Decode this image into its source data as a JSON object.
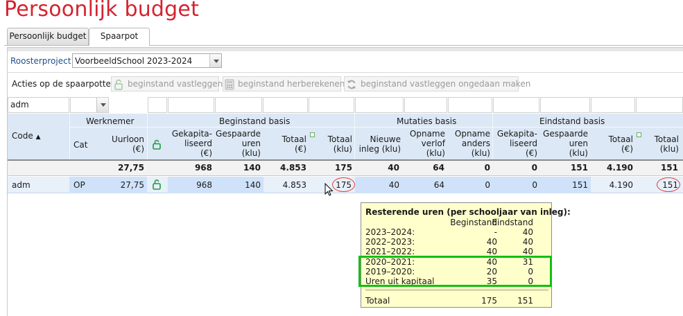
{
  "page": {
    "title": "Persoonlijk budget"
  },
  "tabs": [
    {
      "label": "Persoonlijk budget",
      "active": false
    },
    {
      "label": "Spaarpot",
      "active": true
    }
  ],
  "toolbar": {
    "project_label": "Roosterproject :",
    "project_value": "VoorbeeldSchool 2023-2024",
    "actions_label": "Acties op de spaarpotten:",
    "buttons": [
      {
        "label": "beginstand vastleggen",
        "icon": "lock-open-icon"
      },
      {
        "label": "beginstand herberekenen",
        "icon": "calculator-icon"
      },
      {
        "label": "beginstand vastleggen ongedaan maken",
        "icon": "undo-refresh-icon"
      }
    ]
  },
  "filter": {
    "code_value": "adm"
  },
  "table": {
    "groups": {
      "werknemer": "Werknemer",
      "beginstand": "Beginstand basis",
      "mutaties": "Mutaties basis",
      "eindstand": "Eindstand basis"
    },
    "columns": {
      "code": "Code",
      "cat": "Cat",
      "uurloon": [
        "Uurloon",
        "(€)"
      ],
      "b_kap": [
        "Gekapita-",
        "liseerd",
        "(€)"
      ],
      "b_gesp": [
        "Gespaarde",
        "uren",
        "(klu)"
      ],
      "b_tot_eur": [
        "Totaal",
        "(€)"
      ],
      "b_tot_klu": [
        "Totaal",
        "(klu)"
      ],
      "m_inleg": [
        "Nieuwe",
        "inleg (klu)"
      ],
      "m_verlof": [
        "Opname",
        "verlof",
        "(klu)"
      ],
      "m_anders": [
        "Opname",
        "anders",
        "(klu)"
      ],
      "e_kap": [
        "Gekapita-",
        "liseerd",
        "(€)"
      ],
      "e_gesp": [
        "Gespaarde",
        "uren",
        "(klu)"
      ],
      "e_tot_eur": [
        "Totaal",
        "(€)"
      ],
      "e_tot_klu": [
        "Totaal",
        "(klu)"
      ]
    },
    "totals": {
      "uurloon": "27,75",
      "b_kap": "968",
      "b_gesp": "140",
      "b_tot_eur": "4.853",
      "b_tot_klu": "175",
      "m_inleg": "40",
      "m_verlof": "64",
      "m_anders": "0",
      "e_kap": "0",
      "e_gesp": "151",
      "e_tot_eur": "4.190",
      "e_tot_klu": "151"
    },
    "rows": [
      {
        "code": "adm",
        "cat": "OP",
        "uurloon": "27,75",
        "b_kap": "968",
        "b_gesp": "140",
        "b_tot_eur": "4.853",
        "b_tot_klu": "175",
        "m_inleg": "40",
        "m_verlof": "64",
        "m_anders": "0",
        "e_kap": "0",
        "e_gesp": "151",
        "e_tot_eur": "4.190",
        "e_tot_klu": "151"
      }
    ]
  },
  "tooltip": {
    "title": "Resterende uren (per schooljaar van inleg):",
    "col_begin": "Beginstand",
    "col_eind": "Eindstand",
    "rows": [
      {
        "label": "2023–2024:",
        "begin": "-",
        "eind": "40"
      },
      {
        "label": "2022–2023:",
        "begin": "40",
        "eind": "40"
      },
      {
        "label": "2021–2022:",
        "begin": "40",
        "eind": "40"
      },
      {
        "label": "2020–2021:",
        "begin": "40",
        "eind": "31"
      },
      {
        "label": "2019–2020:",
        "begin": "20",
        "eind": "0"
      },
      {
        "label": "Uren uit kapitaal",
        "begin": "35",
        "eind": "0"
      }
    ],
    "total": {
      "label": "Totaal",
      "begin": "175",
      "eind": "151"
    }
  },
  "colors": {
    "title": "#d4232f",
    "header": "#dce8f5",
    "row_highlight": "#cfe2fa",
    "tooltip": "#ffffcc",
    "annotation_circle": "#e03a3a",
    "annotation_box": "#11c011"
  }
}
